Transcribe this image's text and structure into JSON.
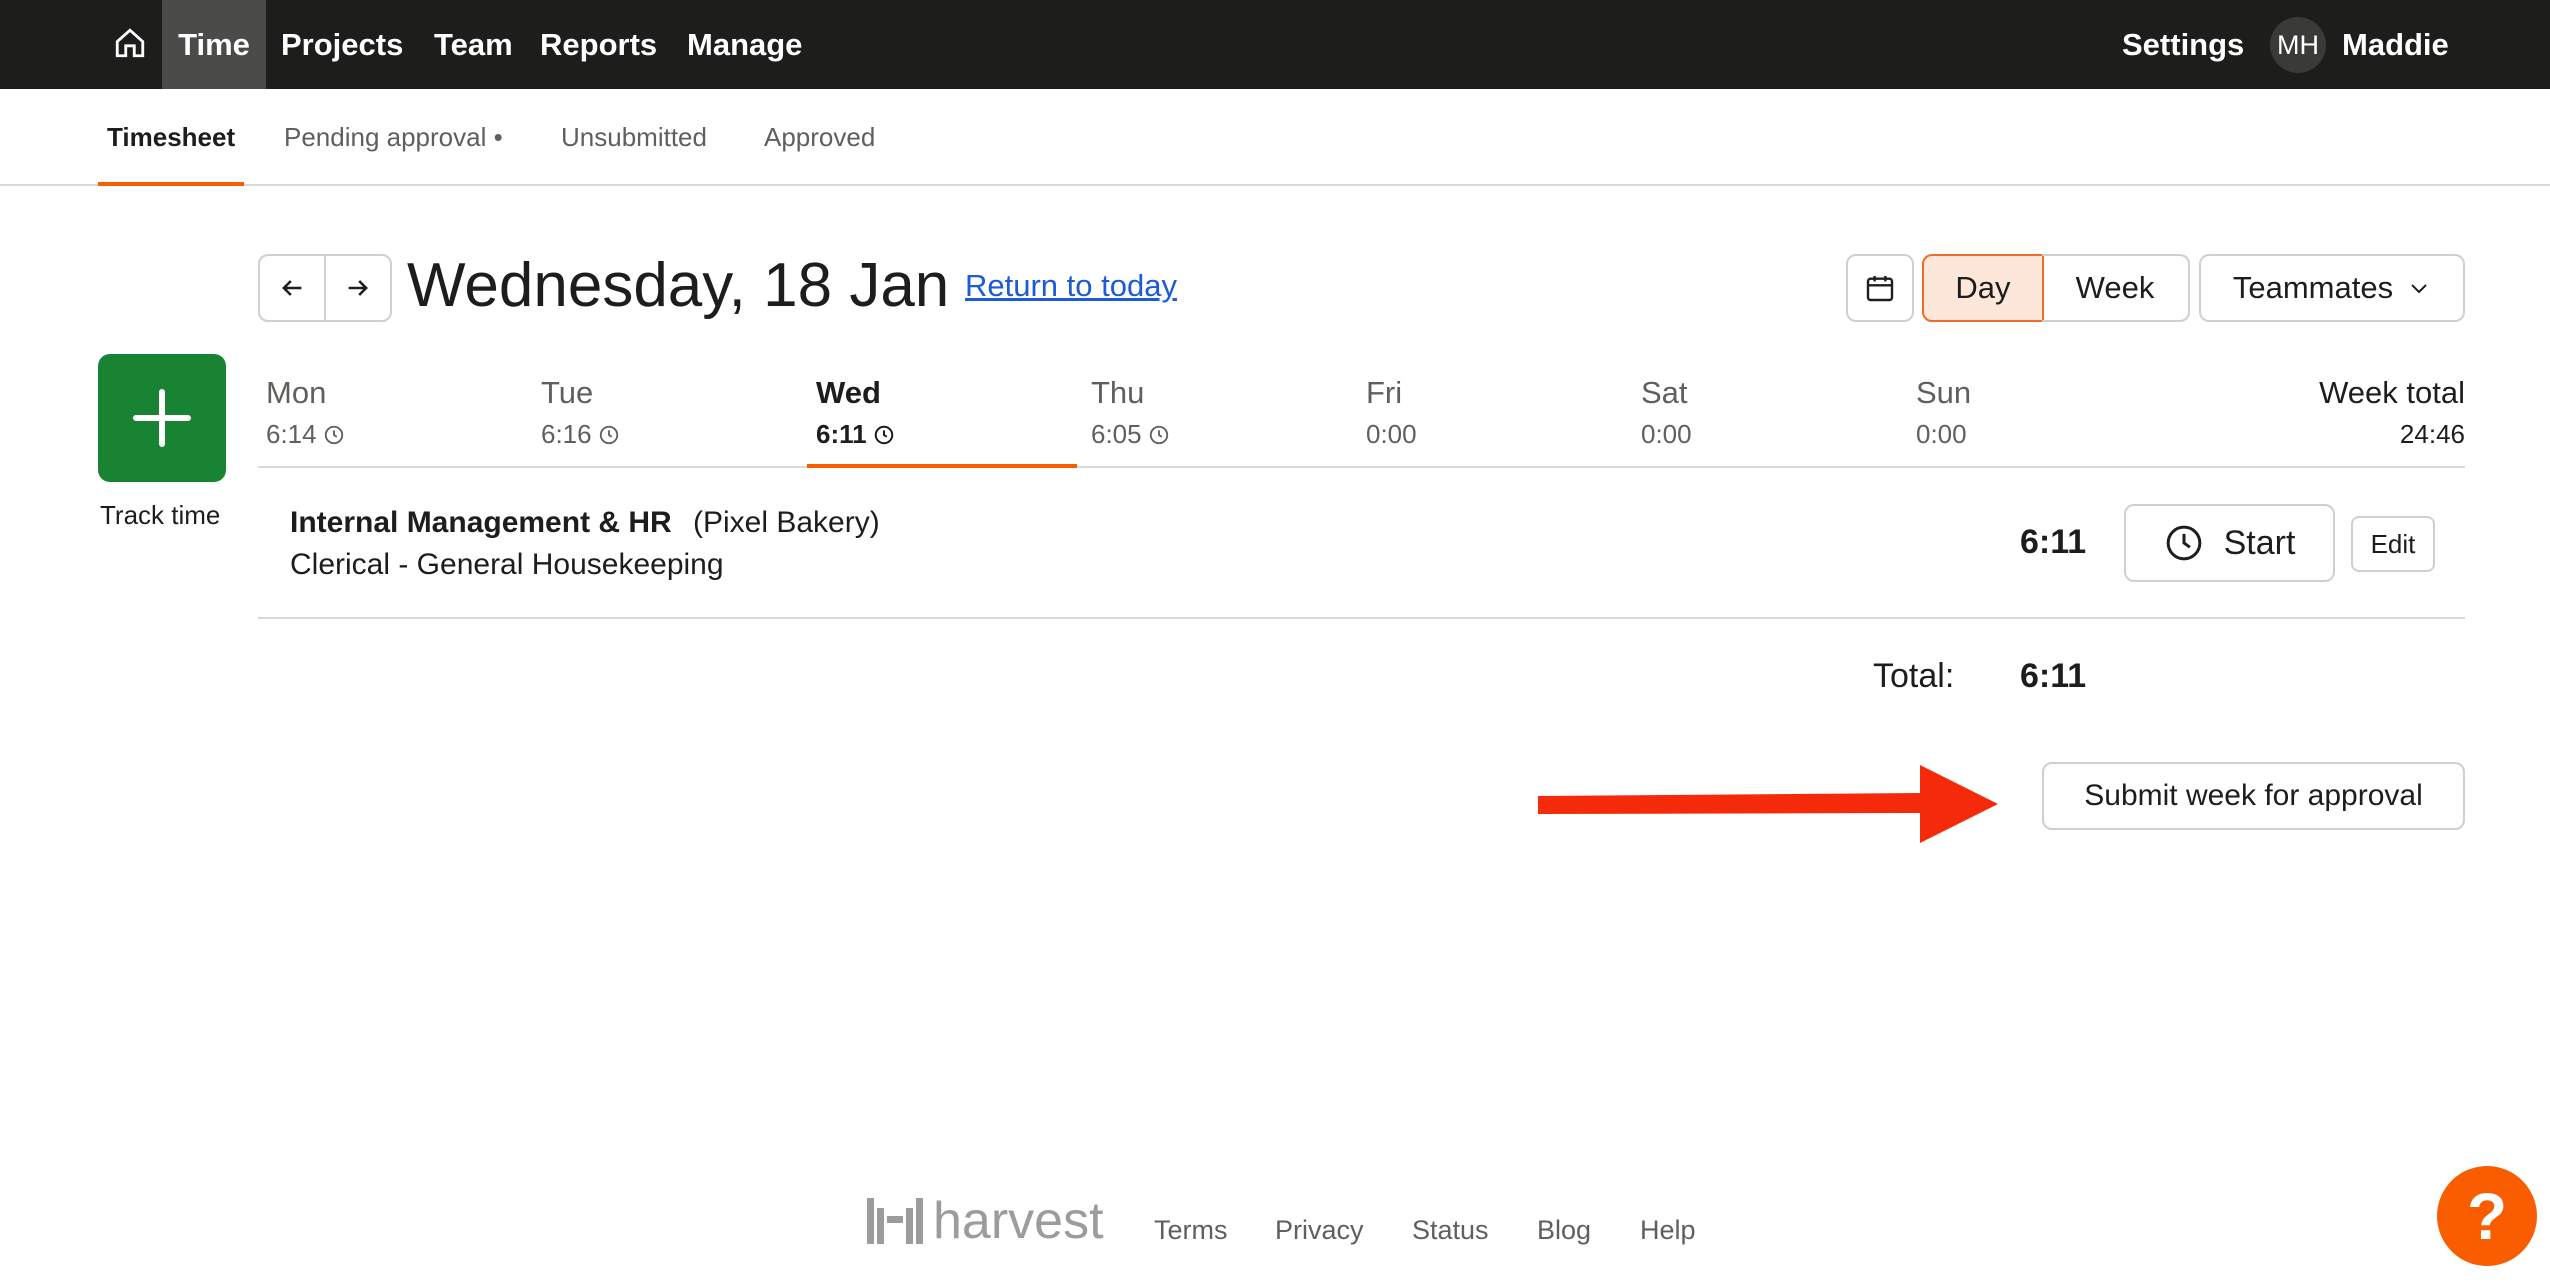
{
  "topnav": {
    "items": [
      "Time",
      "Projects",
      "Team",
      "Reports",
      "Manage"
    ],
    "settings": "Settings",
    "avatar_initials": "MH",
    "user_name": "Maddie"
  },
  "subnav": {
    "tabs": [
      "Timesheet",
      "Pending approval •",
      "Unsubmitted",
      "Approved"
    ]
  },
  "header": {
    "date_title": "Wednesday, 18 Jan",
    "return_link": "Return to today",
    "view_day": "Day",
    "view_week": "Week",
    "teammates": "Teammates"
  },
  "track": {
    "label": "Track time"
  },
  "week": {
    "days": [
      {
        "name": "Mon",
        "time": "6:14"
      },
      {
        "name": "Tue",
        "time": "6:16"
      },
      {
        "name": "Wed",
        "time": "6:11"
      },
      {
        "name": "Thu",
        "time": "6:05"
      },
      {
        "name": "Fri",
        "time": "0:00"
      },
      {
        "name": "Sat",
        "time": "0:00"
      },
      {
        "name": "Sun",
        "time": "0:00"
      }
    ],
    "total_label": "Week total",
    "total_value": "24:46"
  },
  "entry": {
    "project": "Internal Management & HR",
    "client": "(Pixel Bakery)",
    "task": "Clerical - General Housekeeping",
    "hours": "6:11",
    "start_label": "Start",
    "edit_label": "Edit"
  },
  "totals": {
    "label": "Total:",
    "value": "6:11"
  },
  "submit": {
    "label": "Submit week for approval"
  },
  "footer": {
    "logo_text": "harvest",
    "links": [
      "Terms",
      "Privacy",
      "Status",
      "Blog",
      "Help"
    ]
  },
  "help_bubble": "?",
  "colors": {
    "accent": "#fa5d00",
    "track_green": "#188433",
    "nav_bg": "#1d1e1c",
    "arrow_red": "#f52a0a",
    "link_blue": "#1d5bd6"
  }
}
